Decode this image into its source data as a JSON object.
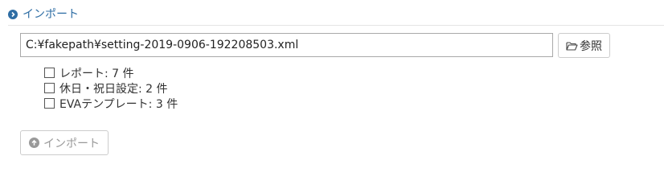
{
  "section": {
    "title": "インポート",
    "icon": "chevron-right-circle-icon"
  },
  "file_input": {
    "value": "C:¥fakepath¥setting-2019-0906-192208503.xml"
  },
  "browse_button": {
    "label": "参照",
    "icon": "folder-open-icon"
  },
  "options": [
    {
      "label": "レポート: 7 件",
      "checked": false
    },
    {
      "label": "休日・祝日設定: 2 件",
      "checked": false
    },
    {
      "label": "EVAテンプレート: 3 件",
      "checked": false
    }
  ],
  "import_button": {
    "label": "インポート",
    "icon": "arrow-up-circle-icon",
    "disabled": true
  },
  "colors": {
    "accent": "#2e6da4",
    "disabled_text": "#999999",
    "border": "#cccccc"
  }
}
